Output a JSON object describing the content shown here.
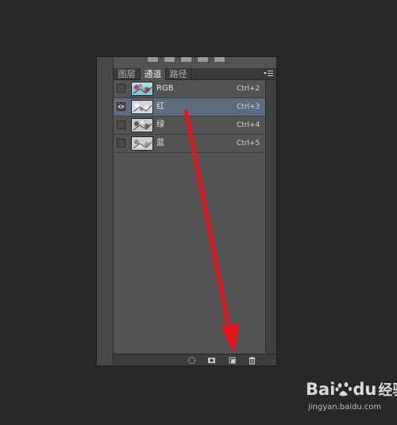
{
  "panel": {
    "tabs": [
      {
        "label": "图层",
        "active": false
      },
      {
        "label": "通道",
        "active": true
      },
      {
        "label": "路径",
        "active": false
      }
    ],
    "channels": [
      {
        "name": "RGB",
        "shortcut": "Ctrl+2",
        "visible": false,
        "selected": false
      },
      {
        "name": "红",
        "shortcut": "Ctrl+3",
        "visible": true,
        "selected": true
      },
      {
        "name": "绿",
        "shortcut": "Ctrl+4",
        "visible": false,
        "selected": false
      },
      {
        "name": "蓝",
        "shortcut": "Ctrl+5",
        "visible": false,
        "selected": false
      }
    ],
    "menu_icon": "panel-menu-icon",
    "bottom_icons": [
      "load-selection-icon",
      "save-selection-mask-icon",
      "new-channel-icon",
      "trash-icon"
    ]
  },
  "annotation": {
    "color": "#e8141c",
    "type": "arrow"
  },
  "watermark": {
    "logo_latin": "Bai",
    "logo_latin2": "du",
    "logo_cn": "经验",
    "url": "jingyan.baidu.com"
  }
}
